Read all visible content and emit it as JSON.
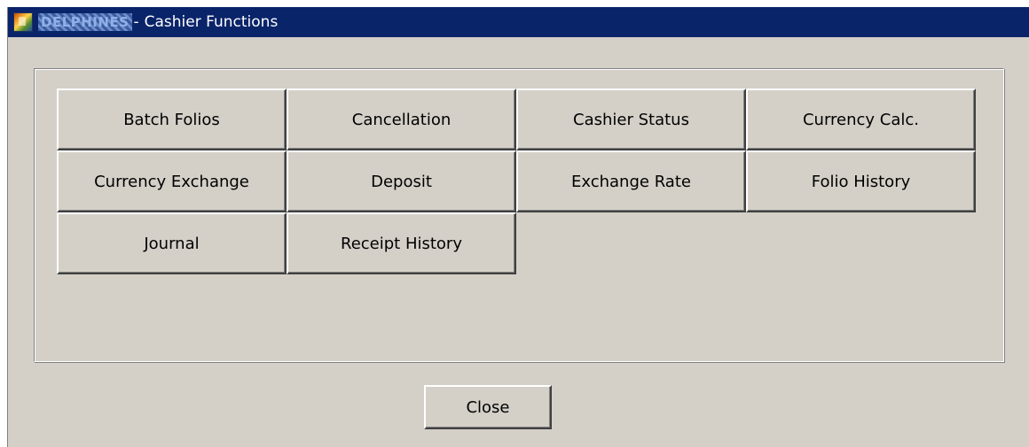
{
  "window": {
    "app_name": "DELPHINES",
    "title_separator": "-",
    "title": "Cashier Functions"
  },
  "functions": [
    {
      "label": "Batch Folios",
      "name": "batch-folios-button"
    },
    {
      "label": "Cancellation",
      "name": "cancellation-button"
    },
    {
      "label": "Cashier Status",
      "name": "cashier-status-button"
    },
    {
      "label": "Currency Calc.",
      "name": "currency-calc-button"
    },
    {
      "label": "Currency Exchange",
      "name": "currency-exchange-button"
    },
    {
      "label": "Deposit",
      "name": "deposit-button"
    },
    {
      "label": "Exchange Rate",
      "name": "exchange-rate-button"
    },
    {
      "label": "Folio History",
      "name": "folio-history-button"
    },
    {
      "label": "Journal",
      "name": "journal-button"
    },
    {
      "label": "Receipt History",
      "name": "receipt-history-button"
    }
  ],
  "close_label": "Close",
  "colors": {
    "titlebar": "#0a246a",
    "face": "#d4d0c8"
  },
  "icons": {
    "app": "app-logo-icon"
  }
}
